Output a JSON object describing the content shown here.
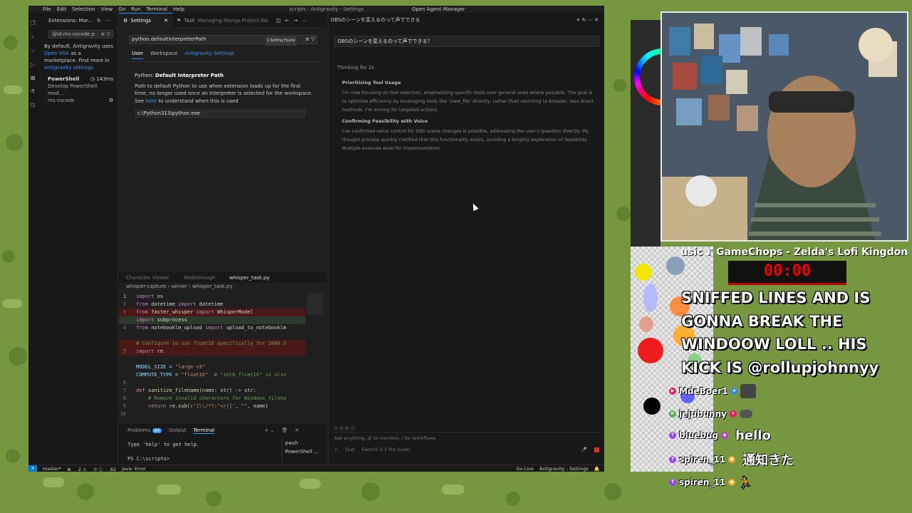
{
  "ide": {
    "menu": [
      "File",
      "Edit",
      "Selection",
      "View",
      "Go",
      "Run",
      "Terminal",
      "Help"
    ],
    "title": "scripts - Antigravity - Settings",
    "agent_manager": "Open Agent Manager"
  },
  "extensions": {
    "header": "Extensions: Mar...",
    "search_value": "@id:ms-vscode.p",
    "note_prefix": "By default, Antigravity uses",
    "note_link": "Open VSX",
    "note_mid": "as a marketplace. Find more in",
    "note_link2": "Antigravity settings.",
    "item_name": "PowerShell",
    "item_time": "143ms",
    "item_desc": "Develop PowerShell mod...",
    "item_publisher": "ms-vscode"
  },
  "tabs": {
    "settings": "Settings",
    "task": "Task",
    "task_desc": "Managing Manga Project Workflo"
  },
  "settings": {
    "search_value": "python.defaultInterpreterPath",
    "found": "1 Setting Found",
    "scopes": [
      "User",
      "Workspace",
      "Antigravity Settings"
    ],
    "name_prefix": "Python:",
    "name": "Default Interpreter Path",
    "desc1": "Path to default Python to use when extension loads up for the first time, no longer used once an interpreter is selected for the workspace. See",
    "desc_link": "here",
    "desc2": "to understand when this is used",
    "value": "c:\\Python313\\python.exe"
  },
  "editor": {
    "tabs": [
      "Character Viewer",
      "Walkthrough",
      "whisper_task.py"
    ],
    "breadcrumb": "whisper-capture  ›  server  ›  whisper_task.py"
  },
  "panel": {
    "tabs": [
      "Problems",
      "Output",
      "Terminal"
    ],
    "problems_count": "84",
    "term_line1": "Type 'help' to get help.",
    "term_line2": "PS C:\\scripts>",
    "term_list": [
      "pwsh",
      "PowerShell ..."
    ]
  },
  "agent": {
    "title": "OBSのシーンを変えるのって声でできる",
    "prompt": "OBSのシーンを変えるのって声でできる？",
    "thinking": "Thinking for 2s",
    "sec1_title": "Prioritizing Tool Usage",
    "sec1_body": "I'm now focusing on tool selection, emphasizing specific tools over general ones where possible. The goal is to optimize efficiency by leveraging tools like 'view_file' directly, rather than resorting to broader, less direct methods. I'm aiming for targeted actions.",
    "sec2_title": "Confirming Feasibility with Voice",
    "sec2_body": "I've confirmed voice control for OBS scene changes is possible, addressing the user's question directly. My thought process quickly clarified that this functionality exists, avoiding a lengthy exploration of feasibility. Multiple avenues exist for implementation.",
    "input_placeholder": "Ask anything, @ to mention, / for workflows",
    "mode": "Fast",
    "model": "Gemini 3.1 Pro (Low)"
  },
  "statusbar": {
    "branch": "master*",
    "errors": "2",
    "warnings": "0",
    "info": "82",
    "java": "Java: Error",
    "golive": "Go Live",
    "settings": "Antigravity - Settings"
  },
  "overlay": {
    "music": "usic ♪ GameChops - Zelda's Lofi Kingdom",
    "timer": "00:00",
    "big_message": "SNIFFED LINES AND IS GONNA BREAK THE WINDOOW LOLL .. HIS KICK IS @rollupjohnnyy",
    "chat": [
      {
        "user": "MdeBoer1",
        "msg": ""
      },
      {
        "user": "jejubunny",
        "msg": ""
      },
      {
        "user": "bluebug",
        "msg": "hello"
      },
      {
        "user": "spiren_11",
        "msg": "通知きた"
      },
      {
        "user": "spiren_11",
        "msg": ""
      }
    ]
  },
  "colors": {
    "accent": "#3794ff",
    "timer_red": "#e00000",
    "status_blue": "#0078d4"
  }
}
